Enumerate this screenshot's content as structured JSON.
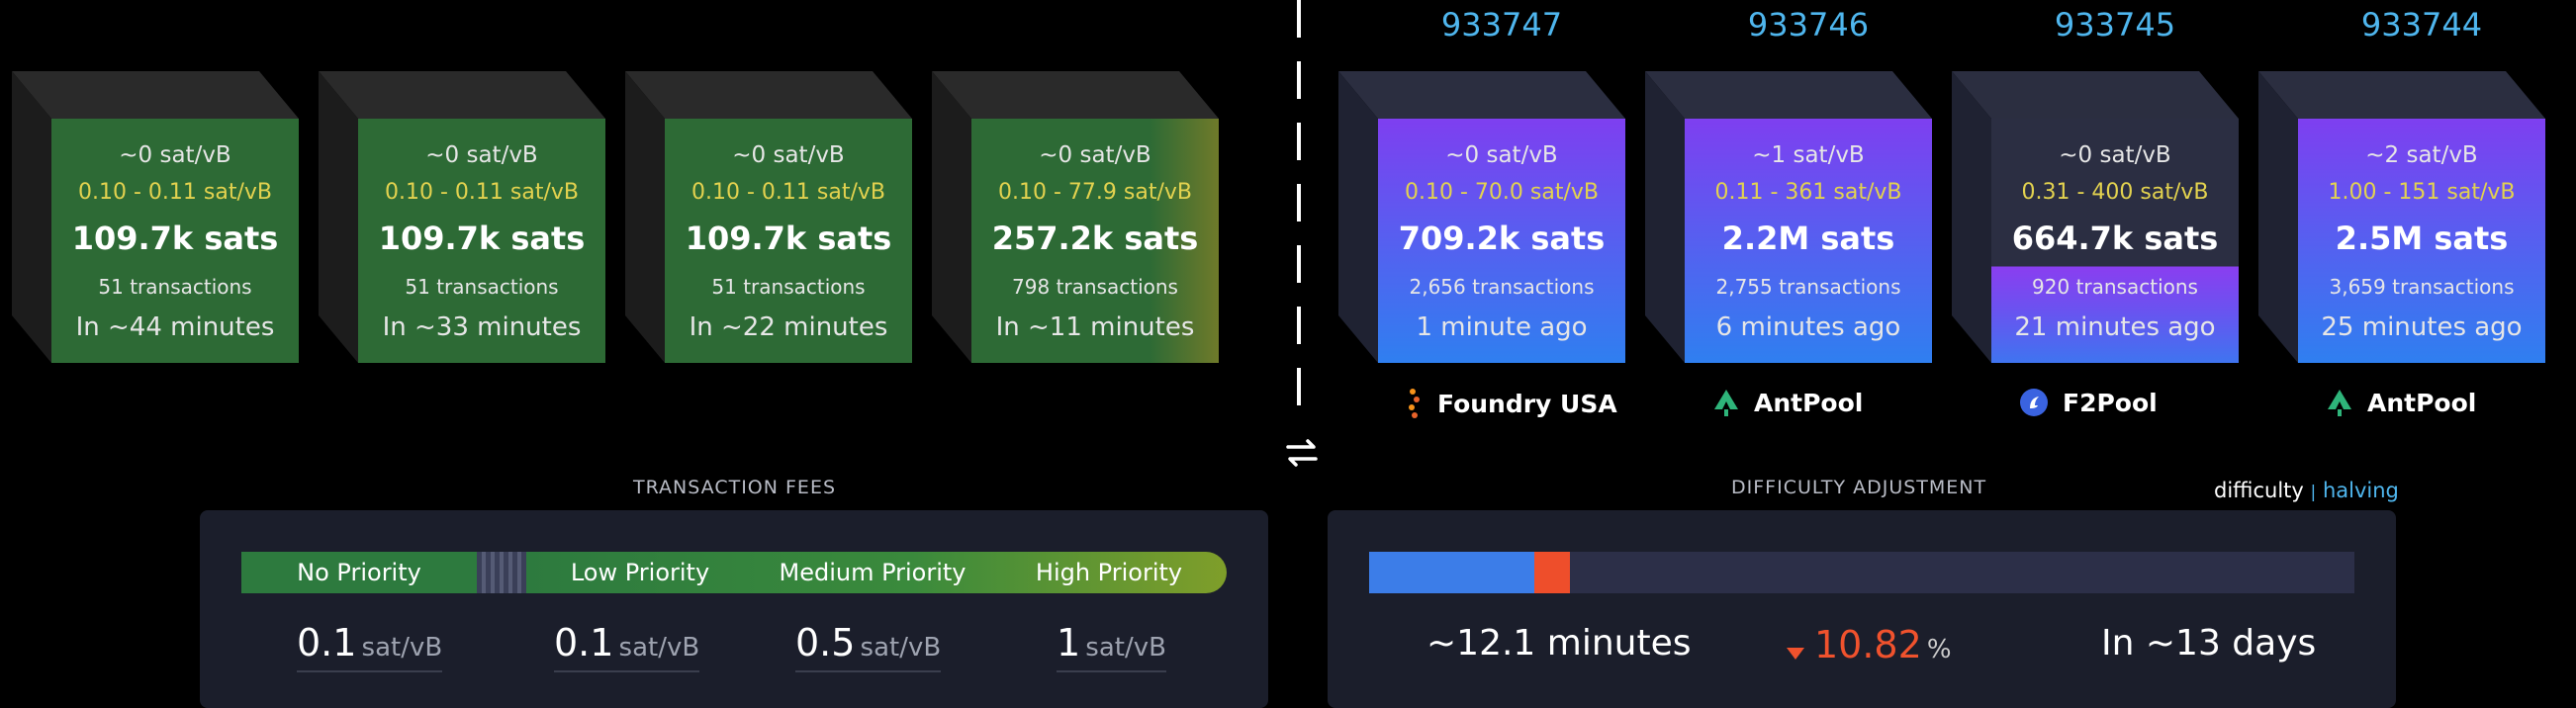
{
  "pending_blocks": [
    {
      "fee": "~0 sat/vB",
      "range": "0.10 - 0.11 sat/vB",
      "size": "109.7k sats",
      "tx": "51 transactions",
      "time": "In ~44 minutes"
    },
    {
      "fee": "~0 sat/vB",
      "range": "0.10 - 0.11 sat/vB",
      "size": "109.7k sats",
      "tx": "51 transactions",
      "time": "In ~33 minutes"
    },
    {
      "fee": "~0 sat/vB",
      "range": "0.10 - 0.11 sat/vB",
      "size": "109.7k sats",
      "tx": "51 transactions",
      "time": "In ~22 minutes"
    },
    {
      "fee": "~0 sat/vB",
      "range": "0.10 - 77.9 sat/vB",
      "size": "257.2k sats",
      "tx": "798 transactions",
      "time": "In ~11 minutes"
    }
  ],
  "mined_blocks": [
    {
      "height": "933747",
      "fee": "~0 sat/vB",
      "range": "0.10 - 70.0 sat/vB",
      "size": "709.2k sats",
      "tx": "2,656 transactions",
      "time": "1 minute ago",
      "pool": "Foundry USA",
      "pool_icon": "foundry-icon"
    },
    {
      "height": "933746",
      "fee": "~1 sat/vB",
      "range": "0.11 - 361 sat/vB",
      "size": "2.2M sats",
      "tx": "2,755 transactions",
      "time": "6 minutes ago",
      "pool": "AntPool",
      "pool_icon": "antpool-icon"
    },
    {
      "height": "933745",
      "fee": "~0 sat/vB",
      "range": "0.31 - 400 sat/vB",
      "size": "664.7k sats",
      "tx": "920 transactions",
      "time": "21 minutes ago",
      "pool": "F2Pool",
      "pool_icon": "f2pool-icon"
    },
    {
      "height": "933744",
      "fee": "~2 sat/vB",
      "range": "1.00 - 151 sat/vB",
      "size": "2.5M sats",
      "tx": "3,659 transactions",
      "time": "25 minutes ago",
      "pool": "AntPool",
      "pool_icon": "antpool-icon"
    }
  ],
  "swap_icon": "swap-arrows-icon",
  "fees": {
    "title": "TRANSACTION FEES",
    "labels": [
      "No Priority",
      "Low Priority",
      "Medium Priority",
      "High Priority"
    ],
    "values": [
      "0.1",
      "0.1",
      "0.5",
      "1"
    ],
    "unit": "sat/vB"
  },
  "difficulty": {
    "title": "DIFFICULTY ADJUSTMENT",
    "tab_difficulty": "difficulty",
    "tab_sep": "|",
    "tab_halving": "halving",
    "progress_blue": 0.168,
    "progress_orange": 0.036,
    "avg_time": "~12.1 minutes",
    "change": "10.82",
    "change_unit": "%",
    "eta": "In ~13 days"
  },
  "colors": {
    "accent_blue": "#4fb6ee",
    "fee_range": "#e3d24f",
    "decrease": "#f0522d"
  }
}
